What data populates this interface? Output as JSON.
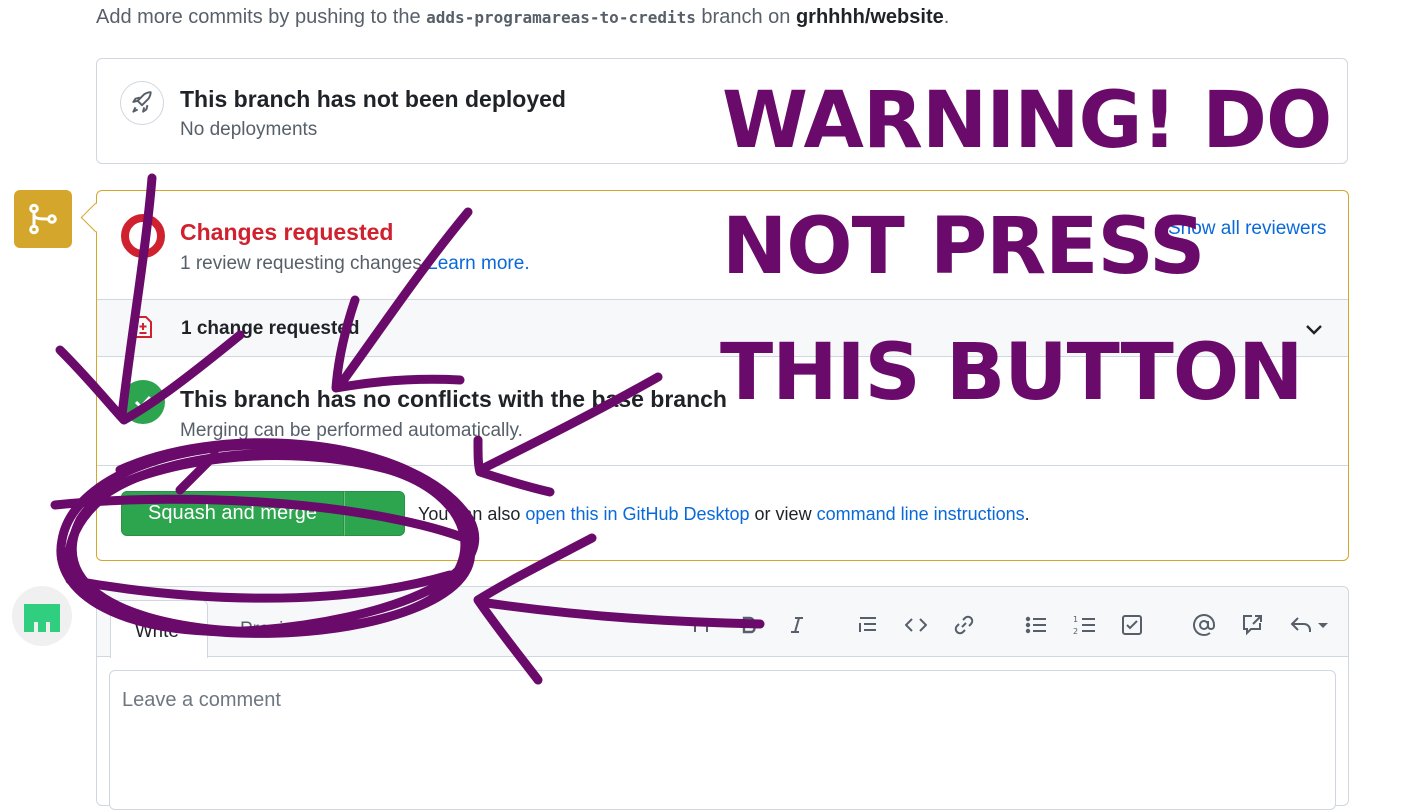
{
  "intro": {
    "prefix": "Add more commits by pushing to the ",
    "branch": "adds-programareas-to-credits",
    "middle": " branch on ",
    "repo": "grhhhh/website",
    "suffix": "."
  },
  "deployment": {
    "title": "This branch has not been deployed",
    "subtitle": "No deployments",
    "icon": "rocket-icon"
  },
  "review": {
    "title": "Changes requested",
    "subtitle": "1 review requesting changes",
    "learn_more": "Learn more.",
    "show_all": "Show all reviewers",
    "changes_row": "1 change requested"
  },
  "conflicts": {
    "title": "This branch has no conflicts with the base branch",
    "subtitle": "Merging can be performed automatically."
  },
  "merge": {
    "button_label": "Squash and merge",
    "alt_prefix": "You can also ",
    "desktop_link": "open this in GitHub Desktop",
    "alt_middle": " or view ",
    "cli_link": "command line instructions",
    "alt_suffix": "."
  },
  "composer": {
    "tab_write": "Write",
    "tab_preview": "Preview",
    "placeholder": "Leave a comment",
    "toolbar": [
      "heading-icon",
      "bold-icon",
      "italic-icon",
      "quote-icon",
      "code-icon",
      "link-icon",
      "bulleted-list-icon",
      "numbered-list-icon",
      "task-list-icon",
      "mention-icon",
      "cross-reference-icon",
      "reply-icon"
    ]
  },
  "overlay": {
    "line1": "WARNING! DO",
    "line2": "NOT PRESS",
    "line3": "THIS BUTTON",
    "color": "#6a0a6a"
  },
  "colors": {
    "merge_green": "#2da44e",
    "warning_yellow": "#d4a72c",
    "danger_red": "#cf222e",
    "link_blue": "#0969da"
  }
}
